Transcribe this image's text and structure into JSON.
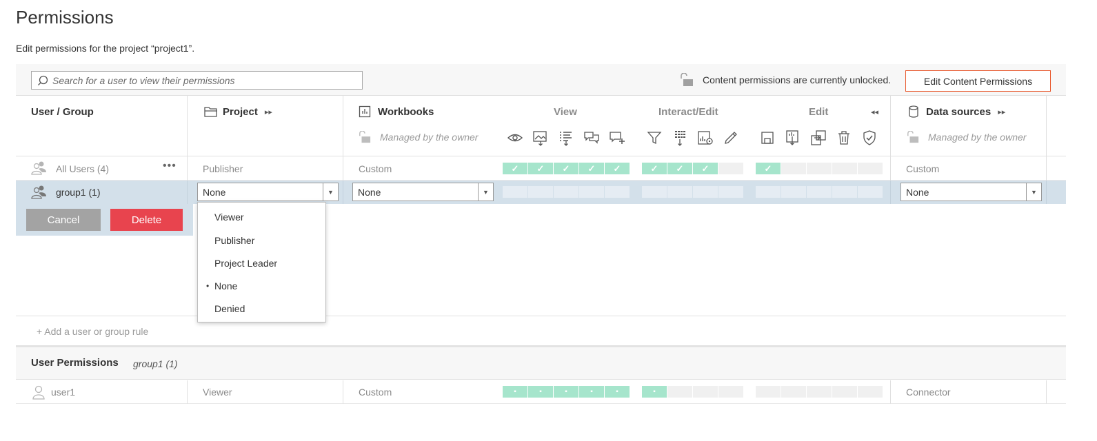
{
  "page": {
    "title": "Permissions",
    "subtitle": "Edit permissions for the project “project1”."
  },
  "toolbar": {
    "search_placeholder": "Search for a user to view their permissions",
    "lock_status": "Content permissions are currently unlocked.",
    "edit_button": "Edit Content Permissions"
  },
  "header": {
    "user_group": "User / Group",
    "project": "Project",
    "workbooks": "Workbooks",
    "view": "View",
    "interact_edit": "Interact/Edit",
    "edit": "Edit",
    "data_sources": "Data sources",
    "managed_by_owner": "Managed by the owner",
    "workbook_capability_icons": [
      "eye-icon",
      "image-download-icon",
      "list-download-icon",
      "comments-icon",
      "add-comment-icon",
      "filter-icon",
      "data-download-icon",
      "web-edit-icon",
      "pencil-icon",
      "save-icon",
      "download-workbook-icon",
      "move-icon",
      "trash-icon",
      "shield-check-icon"
    ]
  },
  "rows": [
    {
      "name": "All Users (4)",
      "project": "Publisher",
      "workbooks": "Custom",
      "view": [
        true,
        true,
        true,
        true,
        true
      ],
      "interact": [
        true,
        true,
        true,
        false
      ],
      "edit": [
        true,
        false,
        false,
        false,
        false
      ],
      "data_sources": "Custom"
    },
    {
      "name": "group1 (1)",
      "project": "None",
      "workbooks": "None",
      "data_sources": "None"
    }
  ],
  "row_actions": {
    "cancel": "Cancel",
    "delete": "Delete"
  },
  "project_menu": {
    "options": [
      "Viewer",
      "Publisher",
      "Project Leader",
      "None",
      "Denied"
    ],
    "selected": "None"
  },
  "add_rule": "+ Add a user or group rule",
  "user_permissions": {
    "title": "User Permissions",
    "group": "group1 (1)",
    "rows": [
      {
        "name": "user1",
        "project": "Viewer",
        "workbooks": "Custom",
        "view": [
          true,
          true,
          true,
          true,
          true
        ],
        "interact": [
          true,
          false,
          false,
          false
        ],
        "edit": [
          false,
          false,
          false,
          false,
          false
        ],
        "data_sources": "Connector"
      }
    ]
  },
  "colors": {
    "allowed": "#a6e5cc",
    "selected_row": "#d3e0ea",
    "delete": "#e8444e",
    "edit_border": "#e8582d"
  }
}
